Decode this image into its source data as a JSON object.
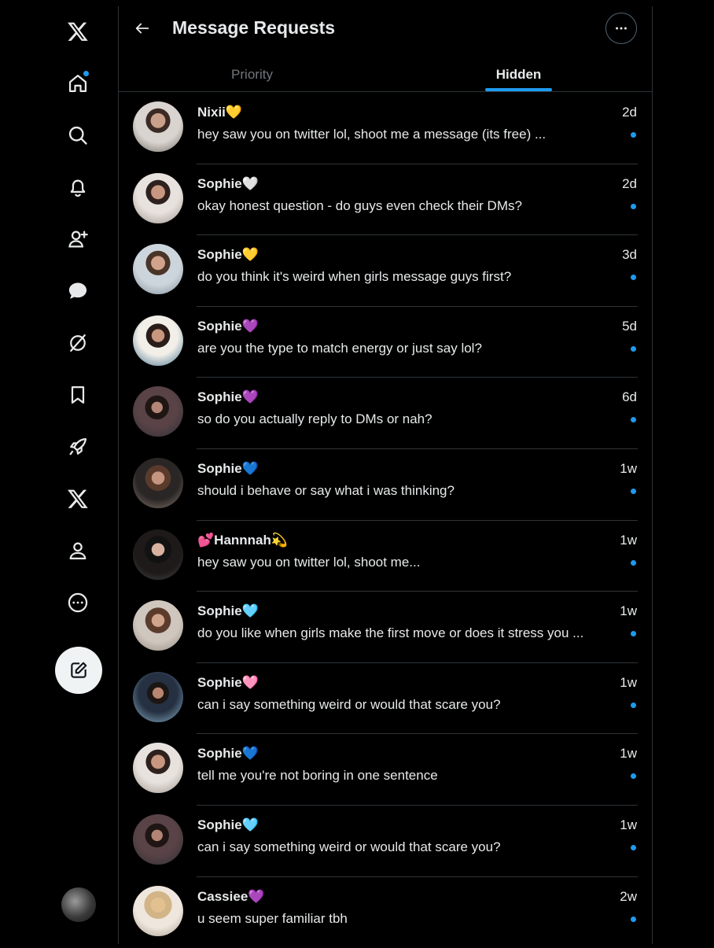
{
  "header": {
    "title": "Message Requests"
  },
  "tabs": [
    {
      "label": "Priority",
      "active": false
    },
    {
      "label": "Hidden",
      "active": true
    }
  ],
  "nav": [
    {
      "icon": "x-logo-icon"
    },
    {
      "icon": "home-icon",
      "badge": true
    },
    {
      "icon": "search-icon"
    },
    {
      "icon": "bell-icon"
    },
    {
      "icon": "add-person-icon"
    },
    {
      "icon": "chat-icon"
    },
    {
      "icon": "slashed-circle-icon"
    },
    {
      "icon": "bookmark-icon"
    },
    {
      "icon": "rocket-icon"
    },
    {
      "icon": "x-premium-icon"
    },
    {
      "icon": "profile-icon"
    },
    {
      "icon": "more-circle-icon"
    }
  ],
  "colors": {
    "accent": "#1d9bf0",
    "background": "#000000",
    "text": "#e7e9ea",
    "muted": "#71767b",
    "divider": "#2f3336"
  },
  "messages": [
    {
      "name": "Nixii💛",
      "preview": "hey saw you on twitter lol, shoot me a message (its free) ...",
      "time": "2d",
      "unread": true
    },
    {
      "name": "Sophie🤍",
      "preview": "okay honest question - do guys even check their DMs?",
      "time": "2d",
      "unread": true
    },
    {
      "name": "Sophie💛",
      "preview": "do you think it's weird when girls message guys first?",
      "time": "3d",
      "unread": true
    },
    {
      "name": "Sophie💜",
      "preview": "are you the type to match energy or just say lol?",
      "time": "5d",
      "unread": true
    },
    {
      "name": "Sophie💜",
      "preview": "so do you actually reply to DMs or nah?",
      "time": "6d",
      "unread": true
    },
    {
      "name": "Sophie💙",
      "preview": "should i behave or say what i was thinking?",
      "time": "1w",
      "unread": true
    },
    {
      "name": "💕Hannnah💫",
      "preview": "hey saw you on twitter lol, shoot me...",
      "time": "1w",
      "unread": true
    },
    {
      "name": "Sophie🩵",
      "preview": "do you like when girls make the first move or does it stress you ...",
      "time": "1w",
      "unread": true
    },
    {
      "name": "Sophie🩷",
      "preview": "can i say something weird or would that scare you?",
      "time": "1w",
      "unread": true
    },
    {
      "name": "Sophie💙",
      "preview": "tell me you're not boring in one sentence",
      "time": "1w",
      "unread": true
    },
    {
      "name": "Sophie🩵",
      "preview": "can i say something weird or would that scare you?",
      "time": "1w",
      "unread": true
    },
    {
      "name": "Cassiee💜",
      "preview": "u seem super familiar tbh",
      "time": "2w",
      "unread": true
    }
  ]
}
